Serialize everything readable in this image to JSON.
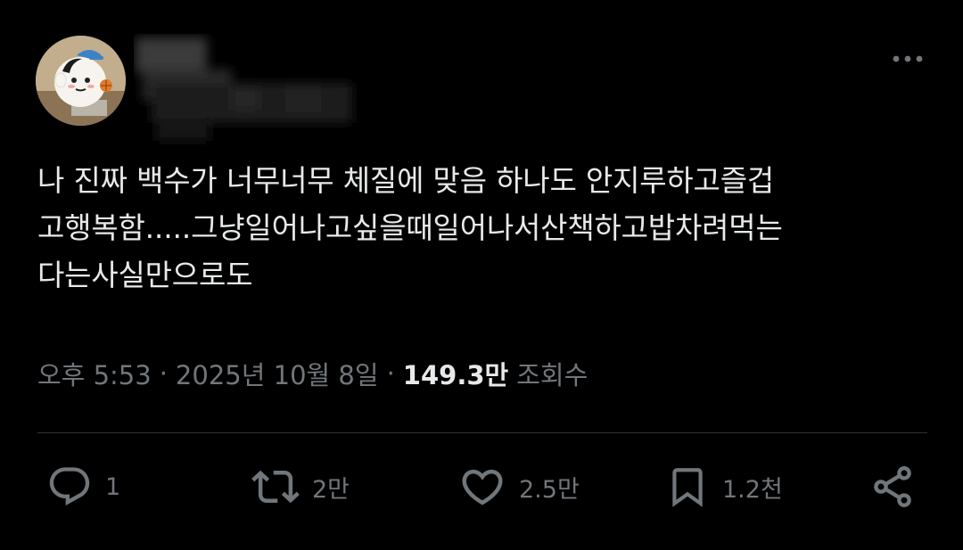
{
  "tweet": {
    "lines": [
      "나 진짜 백수가 너무너무 체질에 맞음 하나도 안지루하고즐겁",
      "고행복함.....그냥일어나고싶을때일어나서산책하고밥차려먹는",
      "다는사실만으로도"
    ]
  },
  "meta": {
    "time": "오후 5:53",
    "separator": "·",
    "date": "2025년 10월 8일",
    "views_count": "149.3만",
    "views_label": "조회수"
  },
  "actions": {
    "reply_count": "1",
    "retweet_count": "2만",
    "like_count": "2.5만",
    "bookmark_count": "1.2천"
  },
  "icons": {
    "more": "more-horizontal-icon",
    "reply": "reply-icon",
    "retweet": "retweet-icon",
    "like": "heart-icon",
    "bookmark": "bookmark-icon",
    "share": "share-icon"
  },
  "colors": {
    "background": "#000000",
    "text_primary": "#e7e9ea",
    "text_secondary": "#71767b",
    "divider": "#2f3336"
  }
}
